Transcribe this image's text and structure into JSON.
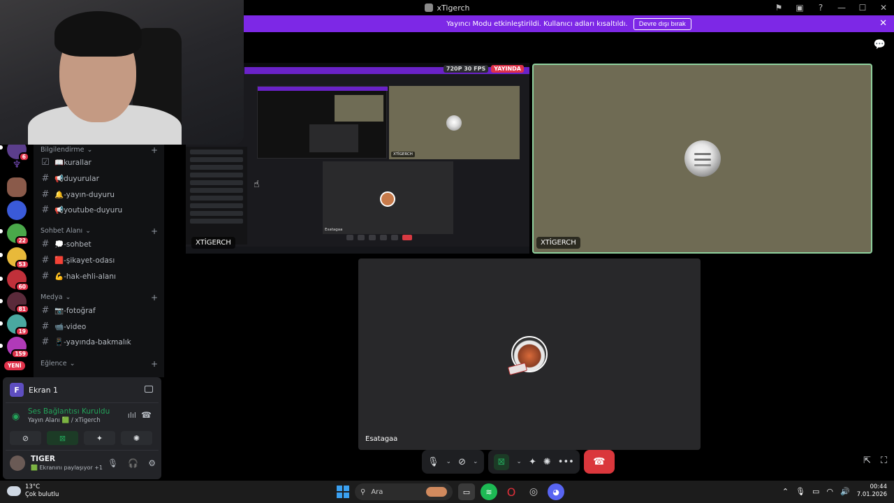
{
  "window": {
    "title": "xTigerch"
  },
  "banner": {
    "message": "Yayıncı Modu etkinleştirildi. Kullanıcı adları kısaltıldı.",
    "button": "Devre dışı bırak"
  },
  "servers": [
    {
      "badge": "6"
    },
    {
      "badge": ""
    },
    {
      "badge": ""
    },
    {
      "badge": ""
    },
    {
      "badge": "22"
    },
    {
      "badge": "53"
    },
    {
      "badge": "60"
    },
    {
      "badge": "81"
    },
    {
      "badge": "19"
    },
    {
      "badge": "159"
    }
  ],
  "new_label": "YENİ",
  "sidebar": {
    "categories": [
      {
        "name": "Bilgilendirme",
        "channels": [
          "📖kurallar",
          "📢duyurular",
          "🔔-yayın-duyuru",
          "📢youtube-duyuru"
        ]
      },
      {
        "name": "Sohbet Alanı",
        "channels": [
          "💭-sohbet",
          "🟥-şikayet-odası",
          "💪-hak-ehli-alanı"
        ]
      },
      {
        "name": "Medya",
        "channels": [
          "📷-fotoğraf",
          "📹-video",
          "📱-yayında-bakmalık"
        ]
      },
      {
        "name": "Eğlence",
        "channels": []
      }
    ]
  },
  "user_panel": {
    "screen_label": "Ekran 1",
    "screen_letter": "F",
    "voice_status": "Ses Bağlantısı Kuruldu",
    "voice_sub": "Yayın Alanı 🟩 / xTigerch",
    "username": "TIGER",
    "user_status": "🟩 Ekranını paylaşıyor +1"
  },
  "stage": {
    "share_label": "XTİGERCH",
    "quality": "720P 30 FPS",
    "live": "YAYINDA",
    "cam_label": "XTİGERCH",
    "user_label": "Esatagaa"
  },
  "taskbar": {
    "weather_temp": "13°C",
    "weather_desc": "Çok bulutlu",
    "search_placeholder": "Ara",
    "time": "00:44",
    "date": "7.01.2026"
  },
  "colors": {
    "banner": "#7d28e6",
    "speaking_border": "#8fd19e",
    "connected_green": "#23a55a",
    "end_call": "#da373c"
  }
}
